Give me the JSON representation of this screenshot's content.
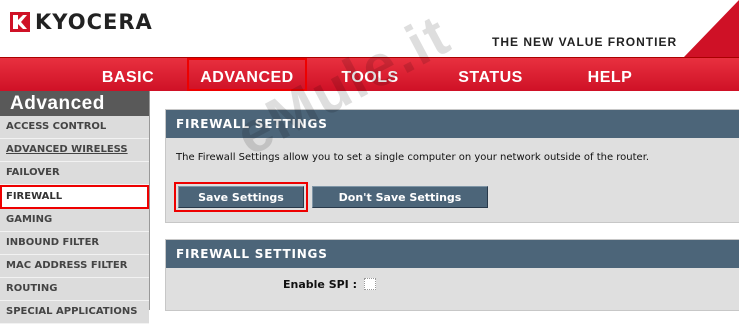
{
  "brand": {
    "name": "KYOCERA",
    "tagline": "THE NEW VALUE FRONTIER"
  },
  "nav": {
    "items": [
      {
        "label": "BASIC"
      },
      {
        "label": "ADVANCED"
      },
      {
        "label": "TOOLS"
      },
      {
        "label": "STATUS"
      },
      {
        "label": "HELP"
      }
    ],
    "active": "ADVANCED"
  },
  "sidebar": {
    "title": "Advanced",
    "items": [
      {
        "label": "ACCESS CONTROL"
      },
      {
        "label": "ADVANCED WIRELESS"
      },
      {
        "label": "FAILOVER"
      },
      {
        "label": "FIREWALL"
      },
      {
        "label": "GAMING"
      },
      {
        "label": "INBOUND FILTER"
      },
      {
        "label": "MAC ADDRESS FILTER"
      },
      {
        "label": "ROUTING"
      },
      {
        "label": "SPECIAL APPLICATIONS"
      }
    ],
    "active": "FIREWALL"
  },
  "firewall_intro": {
    "title": "FIREWALL SETTINGS",
    "description": "The Firewall Settings allow you to set a single computer on your network outside of the router.",
    "save_label": "Save Settings",
    "dont_save_label": "Don't Save Settings"
  },
  "firewall_settings": {
    "title": "FIREWALL SETTINGS",
    "spi_label": "Enable SPI :",
    "spi_checked": false
  },
  "watermark": "eMule.it",
  "colors": {
    "nav_red": "#cf1126",
    "panel_header": "#4c6579",
    "sidebar_title": "#595959",
    "highlight": "#e00000"
  }
}
